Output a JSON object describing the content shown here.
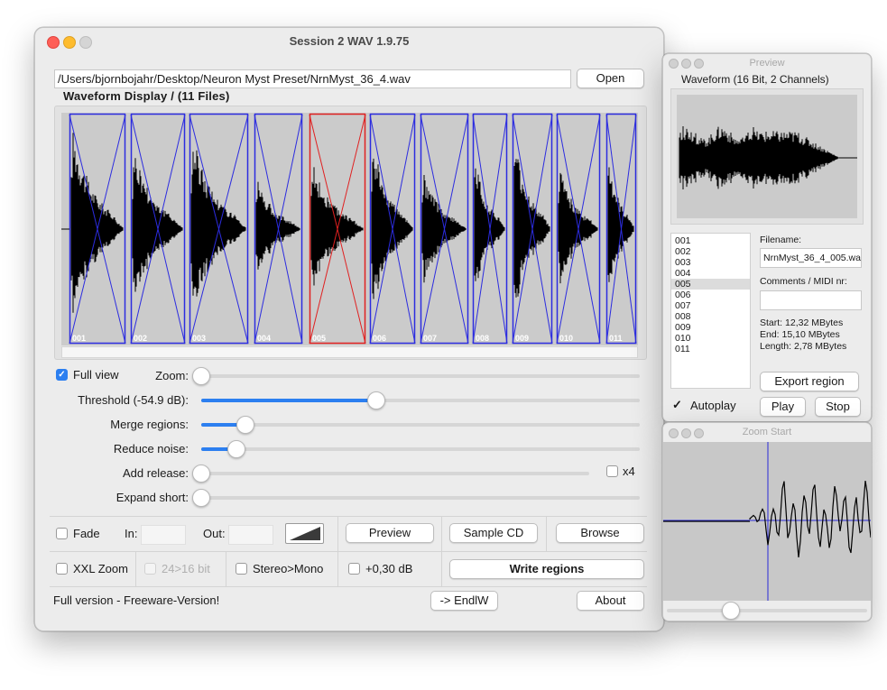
{
  "main_window": {
    "title": "Session 2 WAV 1.9.75",
    "path_value": "/Users/bjornbojahr/Desktop/Neuron Myst Preset/NrnMyst_36_4.wav",
    "open_label": "Open",
    "waveform_title": "Waveform Display / (11 Files)",
    "regions": [
      {
        "label": "001",
        "selected": false
      },
      {
        "label": "002",
        "selected": false
      },
      {
        "label": "003",
        "selected": false
      },
      {
        "label": "004",
        "selected": false
      },
      {
        "label": "005",
        "selected": true
      },
      {
        "label": "006",
        "selected": false
      },
      {
        "label": "007",
        "selected": false
      },
      {
        "label": "008",
        "selected": false
      },
      {
        "label": "009",
        "selected": false
      },
      {
        "label": "010",
        "selected": false
      },
      {
        "label": "011",
        "selected": false
      }
    ],
    "full_view_label": "Full view",
    "full_view_checked": true,
    "sliders": [
      {
        "label": "Zoom:",
        "value": 0.0
      },
      {
        "label": "Threshold (-54.9 dB):",
        "value": 0.4
      },
      {
        "label": "Merge regions:",
        "value": 0.1
      },
      {
        "label": "Reduce noise:",
        "value": 0.08
      },
      {
        "label": "Add release:",
        "value": 0.0
      },
      {
        "label": "Expand short:",
        "value": 0.0
      }
    ],
    "x4_label": "x4",
    "fade_label": "Fade",
    "in_label": "In:",
    "out_label": "Out:",
    "preview_label": "Preview",
    "sample_cd_label": "Sample CD",
    "browse_label": "Browse",
    "xxl_zoom_label": "XXL Zoom",
    "bit_label": "24>16 bit",
    "stereo_mono_label": "Stereo>Mono",
    "gain_label": "+0,30 dB",
    "write_regions_label": "Write regions",
    "version_text": "Full version -  Freeware-Version!",
    "endlw_label": "-> EndlW",
    "about_label": "About"
  },
  "preview_window": {
    "title": "Preview",
    "waveform_label": "Waveform (16 Bit, 2 Channels)",
    "files": [
      "001",
      "002",
      "003",
      "004",
      "005",
      "006",
      "007",
      "008",
      "009",
      "010",
      "011"
    ],
    "selected_file": "005",
    "filename_label": "Filename:",
    "filename_value": "NrnMyst_36_4_005.wav",
    "comments_label": "Comments / MIDI nr:",
    "comments_value": "",
    "start_text": "Start: 12,32 MBytes",
    "end_text": "End: 15,10 MBytes",
    "length_text": "Length: 2,78 MBytes",
    "export_label": "Export region",
    "autoplay_label": "Autoplay",
    "autoplay_checked": true,
    "play_label": "Play",
    "stop_label": "Stop"
  },
  "zoom_window": {
    "title": "Zoom Start",
    "slider_value": 0.32
  },
  "colors": {
    "region_border": "#2c2ce0",
    "region_selected": "#e02020",
    "accent": "#2c7ff0"
  }
}
